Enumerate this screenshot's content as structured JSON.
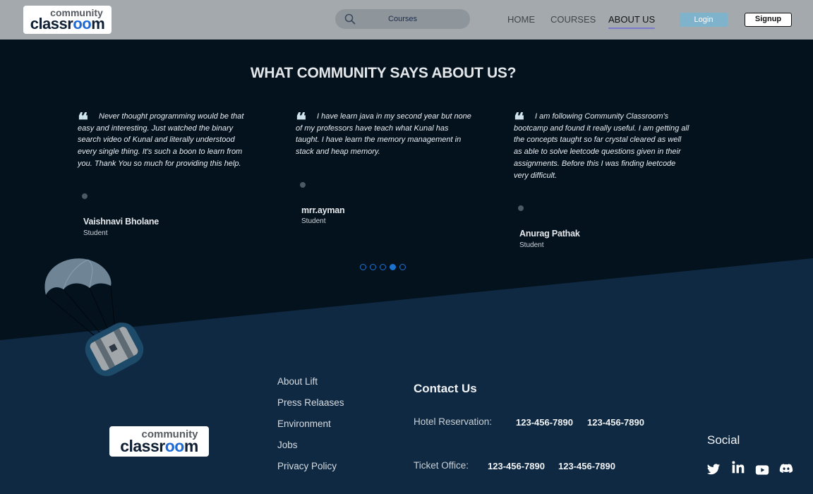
{
  "header": {
    "logo_top": "community",
    "logo_bottom_pre": "classr",
    "logo_bottom_oo": "oo",
    "logo_bottom_post": "m",
    "search_placeholder": "Courses",
    "nav": [
      "HOME",
      "COURSES",
      "ABOUT US"
    ],
    "active_nav": "ABOUT US",
    "login": "Login",
    "signup": "Signup"
  },
  "testimonials": {
    "title": "WHAT COMMUNITY SAYS ABOUT US?",
    "items": [
      {
        "quote": "Never thought programming would be that easy and interesting. Just watched the binary search video of Kunal and literally understood every single thing. It's such a boon to learn from you. Thank You so much for providing this help.",
        "name": "Vaishnavi Bholane",
        "role": "Student"
      },
      {
        "quote": "I have learn java in my second year but none of my professors have teach what Kunal has taught. I have learn the memory management in stack and heap memory.",
        "name": "mrr.ayman",
        "role": "Student"
      },
      {
        "quote": "I am following Community Classroom's bootcamp and found it really useful. I am getting all the concepts taught so far crystal cleared as well as able to solve leetcode questions given in their assignments. Before this I was finding leetcode very difficult.",
        "name": "Anurag Pathak",
        "role": "Student"
      }
    ],
    "pager_count": 5,
    "pager_active_index": 3
  },
  "footer": {
    "links": [
      "About Lift",
      "Press Relaases",
      "Environment",
      "Jobs",
      "Privacy Policy"
    ],
    "contact_title": "Contact Us",
    "hotel_label": "Hotel Reservation:",
    "hotel_numbers": [
      "123-456-7890",
      "123-456-7890"
    ],
    "ticket_label": "Ticket Office:",
    "ticket_numbers": [
      "123-456-7890",
      "123-456-7890"
    ],
    "social_title": "Social",
    "social_icons": [
      "twitter-icon",
      "linkedin-icon",
      "youtube-icon",
      "discord-icon"
    ]
  },
  "colors": {
    "header_bg": "#a4a9ad",
    "section_bg": "#04121e",
    "footer_bg": "#0f2942",
    "accent": "#1c73cf",
    "login_bg": "#7fb3cc"
  }
}
